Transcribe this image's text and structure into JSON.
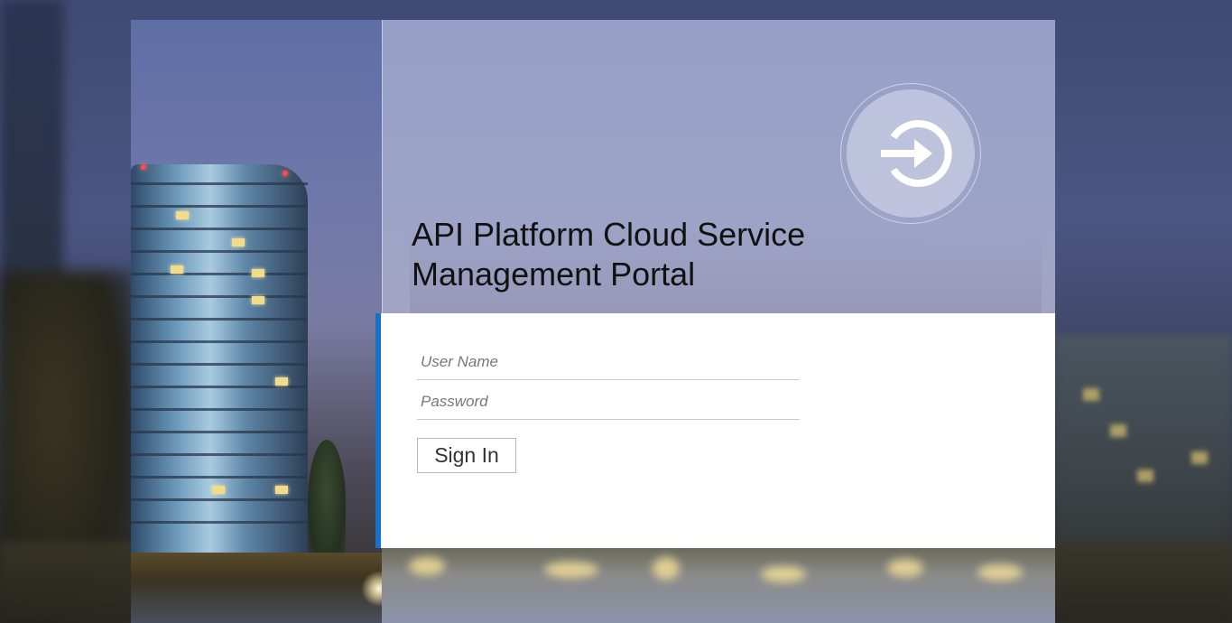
{
  "header": {
    "title_line1": "API Platform Cloud Service",
    "title_line2": "Management Portal"
  },
  "login_form": {
    "username_placeholder": "User Name",
    "password_placeholder": "Password",
    "signin_label": "Sign In"
  },
  "colors": {
    "accent_bar": "#1672c8",
    "form_background": "#ffffff",
    "title_text": "#111111"
  },
  "icons": {
    "hero_icon": "sign-in-arrow-icon"
  }
}
